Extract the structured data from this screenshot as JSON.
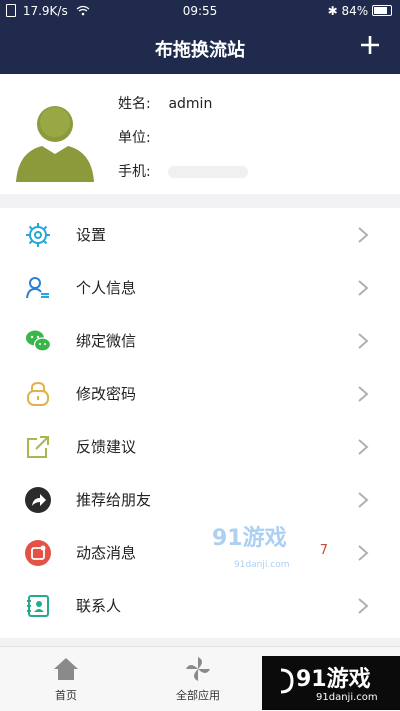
{
  "status_bar": {
    "speed": "17.9K/s",
    "time": "09:55",
    "battery": "84%",
    "icons": [
      "sim-icon",
      "wifi-icon",
      "bluetooth-icon",
      "battery-icon"
    ]
  },
  "header": {
    "title": "布拖换流站",
    "add_icon": "plus-icon"
  },
  "profile": {
    "avatar_icon": "user-avatar-icon",
    "name_label": "姓名:",
    "name_value": "admin",
    "unit_label": "单位:",
    "unit_value": "",
    "phone_label": "手机:",
    "phone_value": ""
  },
  "menu": {
    "items": [
      {
        "label": "设置",
        "icon": "gear-icon",
        "color": "#27a7d9"
      },
      {
        "label": "个人信息",
        "icon": "person-info-icon",
        "color": "#2a7fd6"
      },
      {
        "label": "绑定微信",
        "icon": "wechat-icon",
        "color": "#39b54a"
      },
      {
        "label": "修改密码",
        "icon": "lock-icon",
        "color": "#e0b24b"
      },
      {
        "label": "反馈建议",
        "icon": "share-square-icon",
        "color": "#a8b84d"
      },
      {
        "label": "推荐给朋友",
        "icon": "share-arrow-icon",
        "color": "#2b2b2b"
      },
      {
        "label": "动态消息",
        "icon": "notification-icon",
        "color": "#e35245",
        "badge": "7"
      },
      {
        "label": "联系人",
        "icon": "contacts-icon",
        "color": "#27a98d"
      }
    ]
  },
  "tabbar": {
    "home_label": "首页",
    "apps_label": "全部应用"
  },
  "watermark": {
    "brand": "91游戏",
    "domain": "91danji.com"
  },
  "colors": {
    "header_bg": "#1f2a4c",
    "badge": "#c94a3c"
  }
}
